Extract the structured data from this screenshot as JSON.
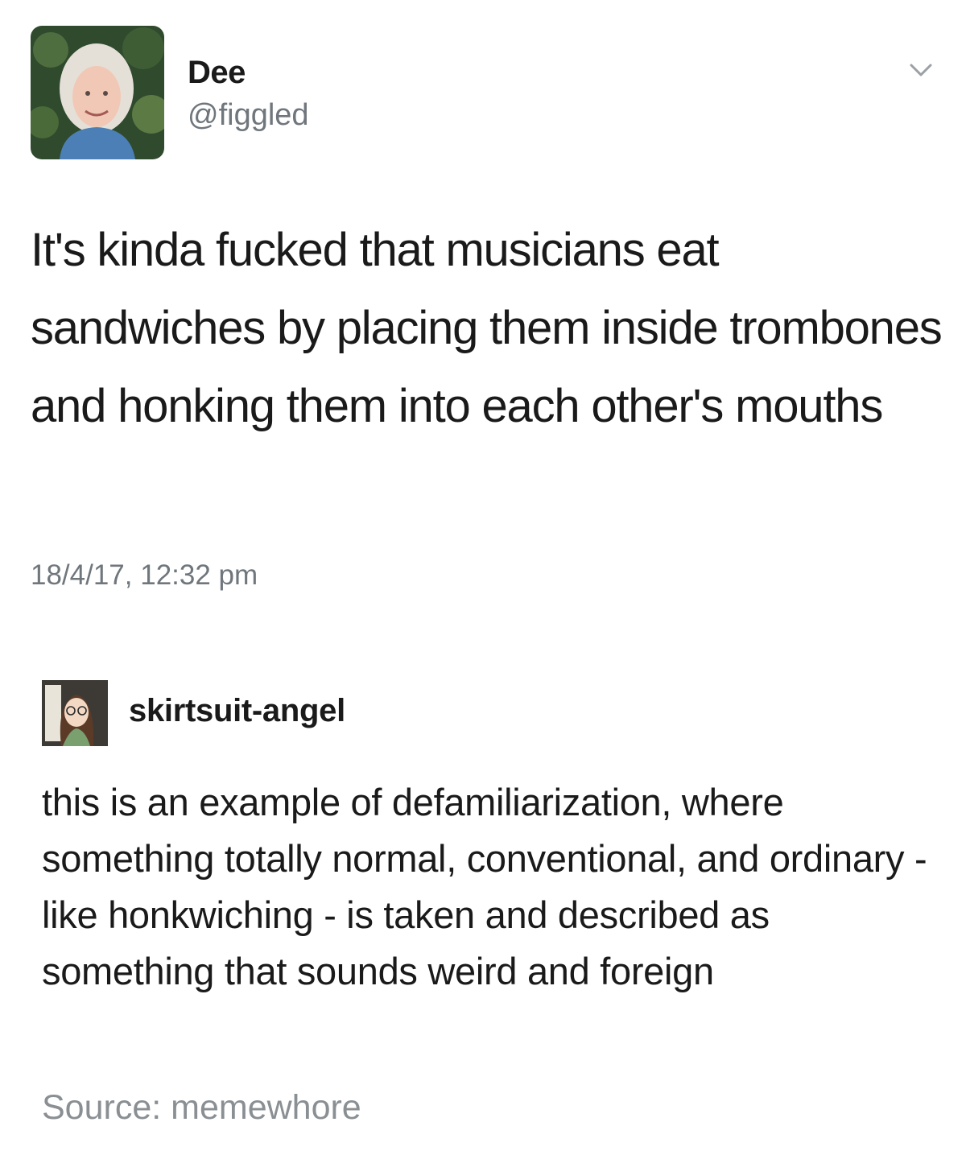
{
  "tweet": {
    "avatar": "profile-photo",
    "display_name": "Dee",
    "handle": "@figgled",
    "menu_icon": "chevron-down-icon",
    "text": "It's kinda fucked that musicians eat sandwiches by placing them inside trombones and honking them into each other's mouths",
    "timestamp": "18/4/17, 12:32 pm"
  },
  "reblog": {
    "avatar": "cartoon-avatar",
    "username": "skirtsuit-angel",
    "text": "this is an example of defamiliarization, where something totally normal, conventional, and ordinary - like honkwiching - is taken and described as something that sounds weird and foreign"
  },
  "source": "Source: memewhore",
  "colors": {
    "text": "#1a1a1a",
    "muted": "#6f767c",
    "source": "#8a8f93",
    "background": "#ffffff"
  }
}
